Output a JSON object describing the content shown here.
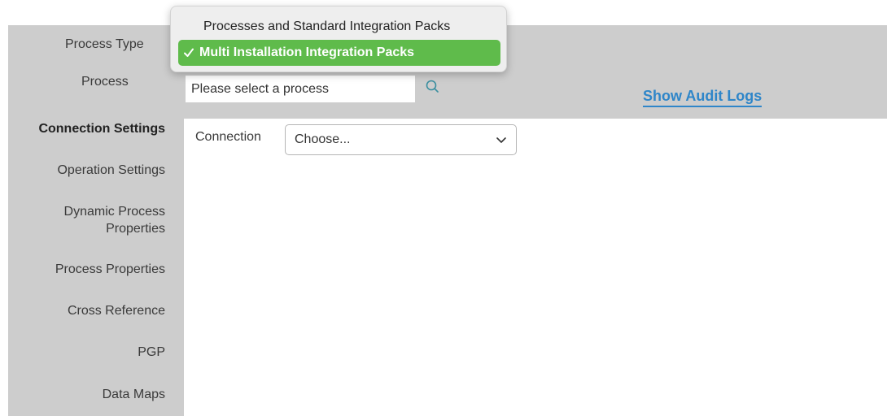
{
  "header": {
    "process_type_label": "Process Type",
    "process_label": "Process",
    "process_placeholder": "Please select a process",
    "audit_link": "Show Audit Logs"
  },
  "process_type_menu": {
    "options": [
      {
        "label": "Processes and Standard Integration Packs",
        "selected": false
      },
      {
        "label": "Multi Installation Integration Packs",
        "selected": true
      }
    ]
  },
  "sidebar": {
    "items": [
      {
        "label": "Connection Settings",
        "active": true
      },
      {
        "label": "Operation Settings",
        "active": false
      },
      {
        "label": "Dynamic Process Properties",
        "active": false
      },
      {
        "label": "Process Properties",
        "active": false
      },
      {
        "label": "Cross Reference",
        "active": false
      },
      {
        "label": "PGP",
        "active": false
      },
      {
        "label": "Data Maps",
        "active": false
      }
    ]
  },
  "content": {
    "connection_label": "Connection",
    "connection_value": "Choose..."
  },
  "colors": {
    "panel_gray": "#cdcdcd",
    "link_blue": "#2f86c9",
    "selected_green": "#5fbb4b",
    "search_icon_teal": "#3a8fa0"
  },
  "icons": {
    "search": "search-icon",
    "check": "check-icon",
    "dropdown": "chevron-down-icon"
  }
}
